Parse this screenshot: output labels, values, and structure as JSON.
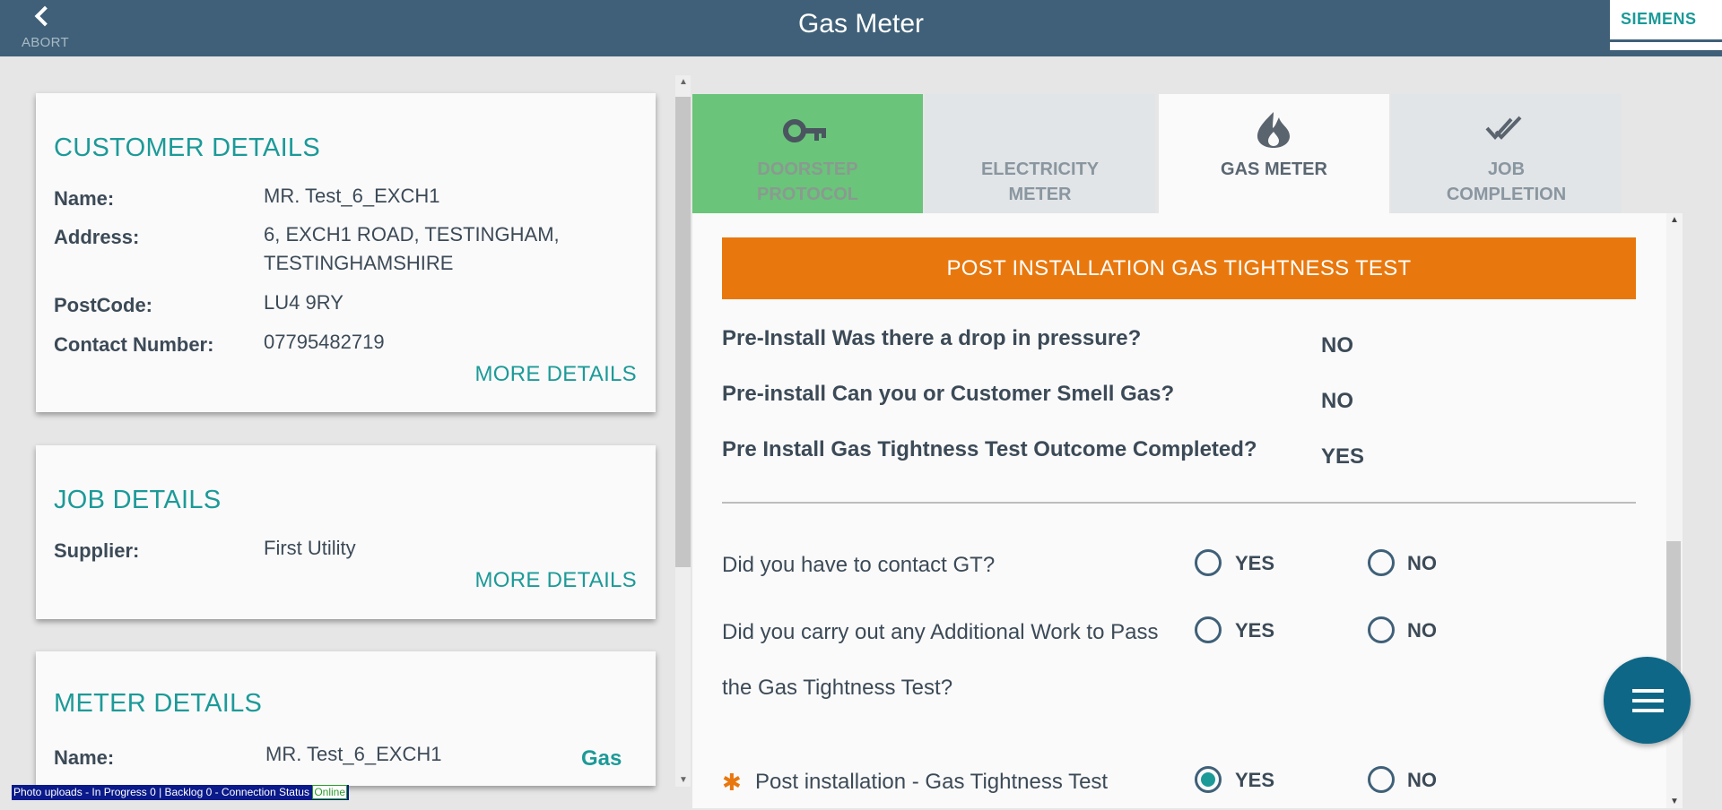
{
  "header": {
    "title": "Gas Meter",
    "abort_label": "ABORT",
    "logo": "SIEMENS"
  },
  "customer_card": {
    "title": "CUSTOMER DETAILS",
    "rows": [
      {
        "label": "Name:",
        "value": "MR. Test_6_EXCH1"
      },
      {
        "label": "Address:",
        "value_line1": "6, EXCH1 ROAD, TESTINGHAM,",
        "value_line2": "TESTINGHAMSHIRE"
      },
      {
        "label": "PostCode:",
        "value": "LU4 9RY"
      },
      {
        "label": "Contact Number:",
        "value": "07795482719"
      }
    ],
    "more": "MORE DETAILS"
  },
  "job_card": {
    "title": "JOB DETAILS",
    "rows": [
      {
        "label": "Supplier:",
        "value": "First Utility"
      }
    ],
    "more": "MORE DETAILS"
  },
  "meter_card": {
    "title": "METER DETAILS",
    "rows": [
      {
        "label": "Name:",
        "value": "MR. Test_6_EXCH1",
        "tag": "Gas"
      }
    ]
  },
  "tabs": [
    {
      "line1": "DOORSTEP",
      "line2": "PROTOCOL",
      "icon": "key-icon",
      "state": "completed"
    },
    {
      "line1": "ELECTRICITY",
      "line2": "METER",
      "icon": "none",
      "state": "inactive"
    },
    {
      "line1": "GAS METER",
      "line2": "",
      "icon": "flame-icon",
      "state": "active"
    },
    {
      "line1": "JOB",
      "line2": "COMPLETION",
      "icon": "double-check-icon",
      "state": "inactive"
    }
  ],
  "section": {
    "title": "POST INSTALLATION GAS TIGHTNESS TEST"
  },
  "pre_install": [
    {
      "q": "Pre-Install Was there a drop in pressure?",
      "a": "NO"
    },
    {
      "q": "Pre-install Can you or Customer Smell Gas?",
      "a": "NO"
    },
    {
      "q": "Pre Install Gas Tightness Test Outcome Completed?",
      "a": "YES"
    }
  ],
  "questions": [
    {
      "text": "Did you have to contact GT?",
      "yes": "YES",
      "no": "NO",
      "selected": "none"
    },
    {
      "text_line1": "Did you carry out any Additional Work to Pass",
      "text_line2": "the Gas Tightness Test?",
      "yes": "YES",
      "no": "NO",
      "selected": "none"
    },
    {
      "text": "Post installation - Gas Tightness Test",
      "required": true,
      "yes": "YES",
      "no": "NO",
      "selected": "yes"
    }
  ],
  "status_bar": {
    "text": "Photo uploads - In Progress 0 | Backlog 0 - Connection Status ",
    "connection": "Online"
  },
  "colors": {
    "header": "#3f6078",
    "accent": "#1c9a98",
    "banner": "#e8780e",
    "tab_completed": "#6ac47a",
    "fab": "#0e6787"
  }
}
